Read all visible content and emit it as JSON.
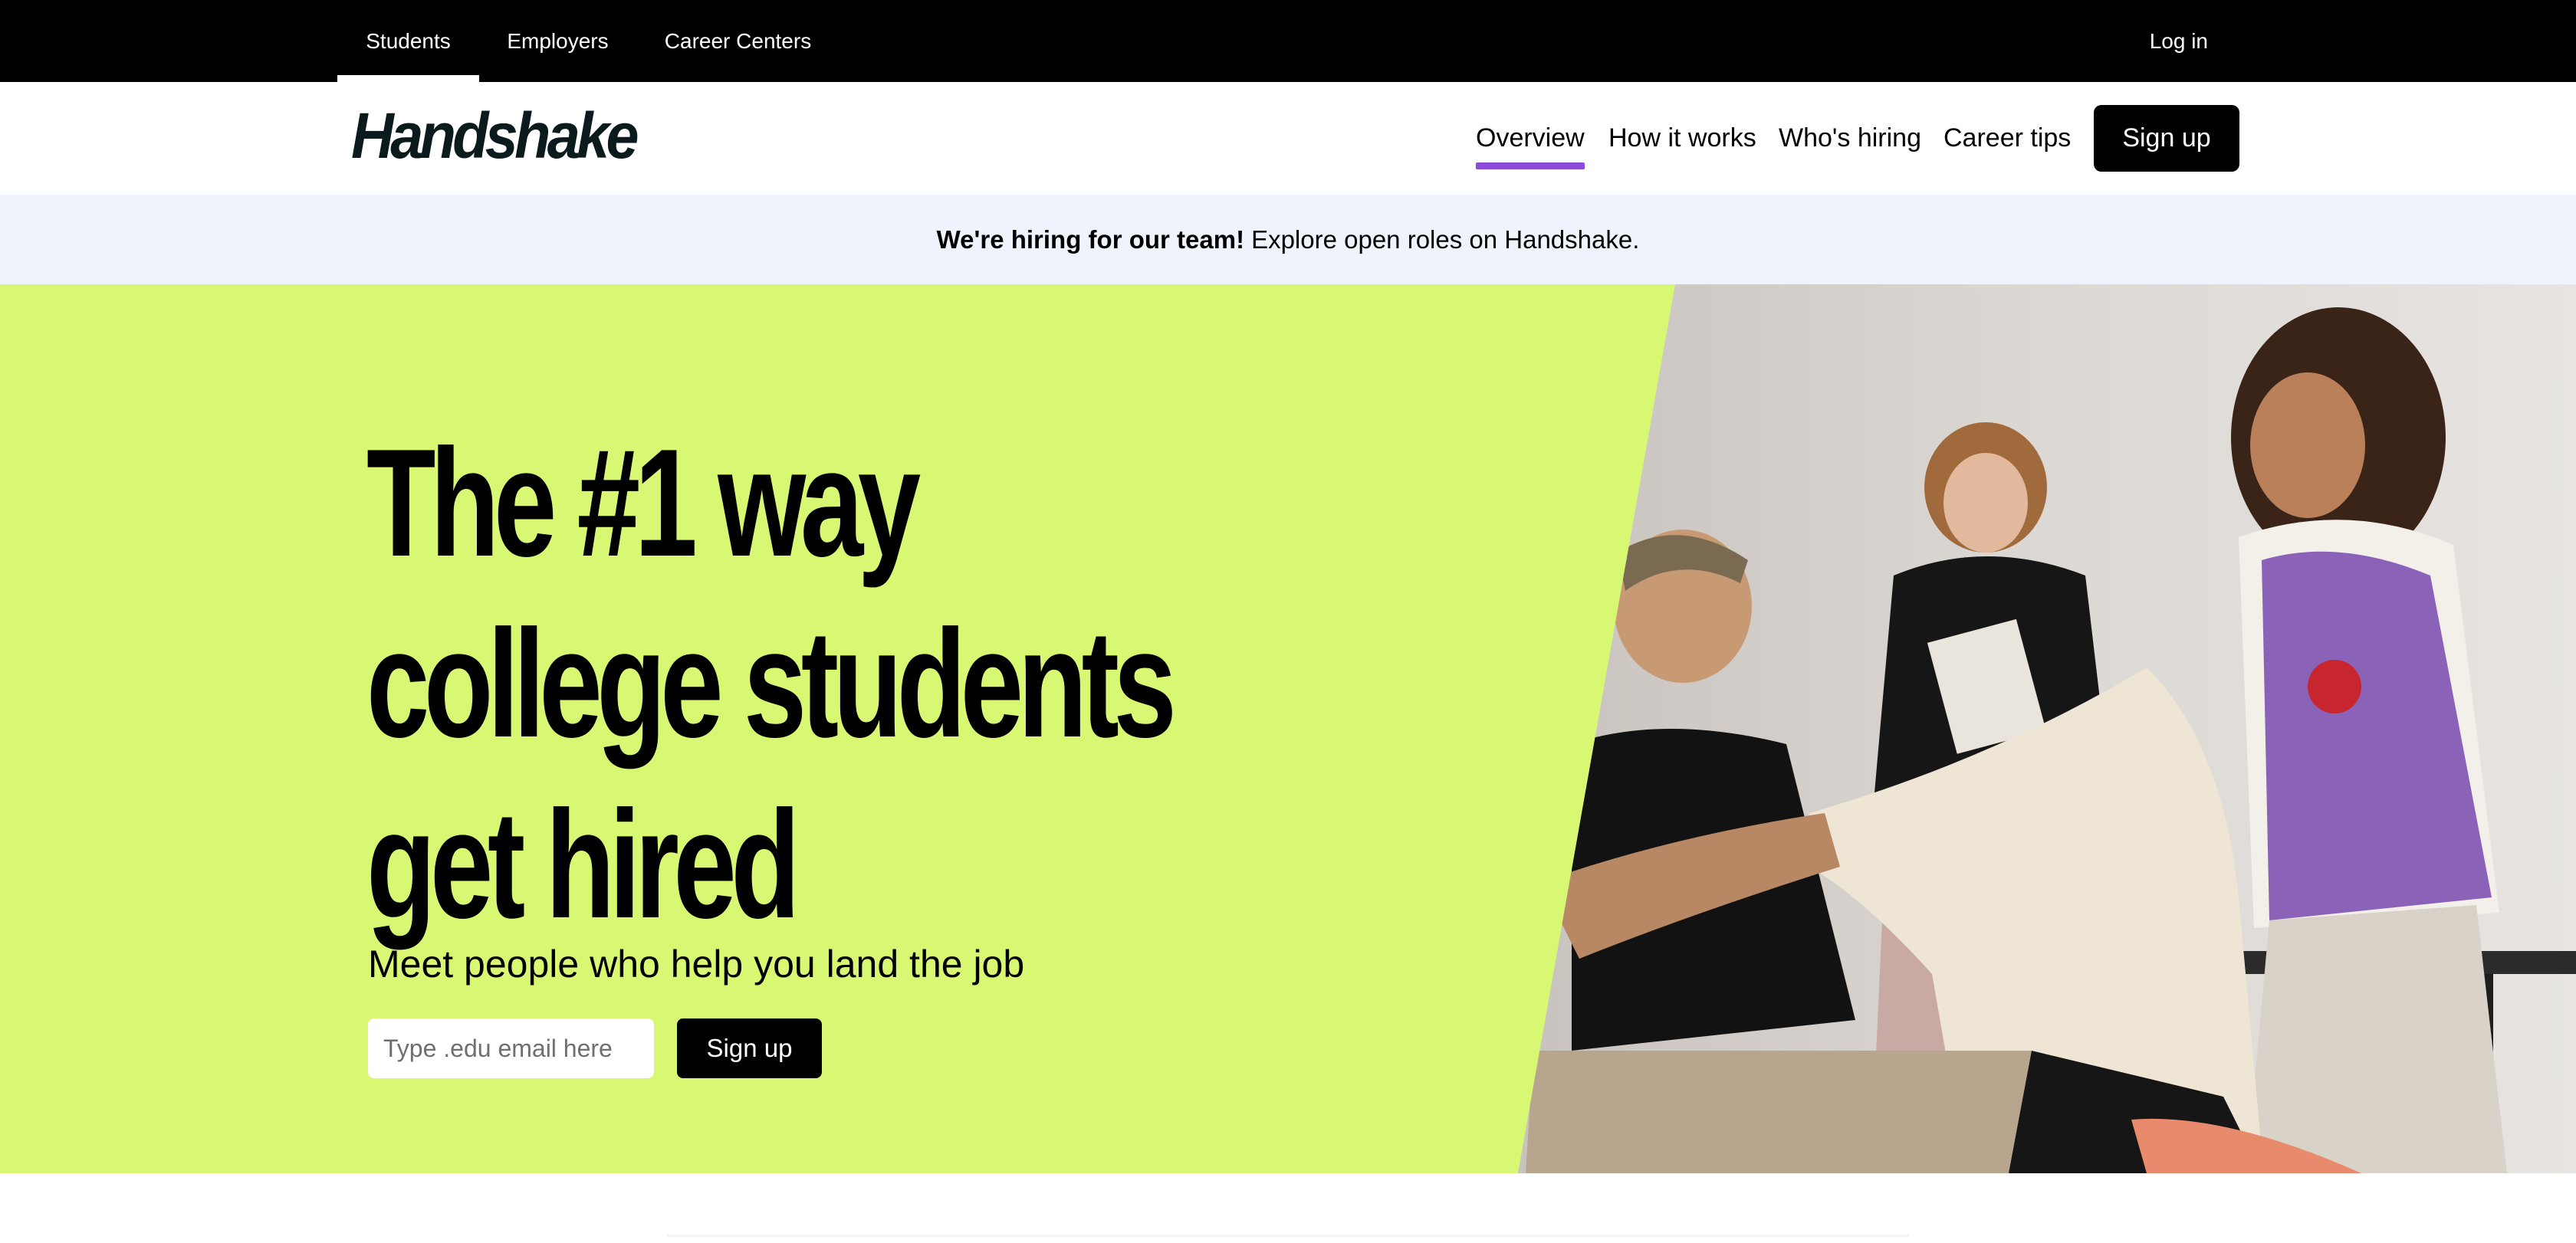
{
  "top_bar": {
    "tabs": [
      {
        "label": "Students",
        "active": true
      },
      {
        "label": "Employers",
        "active": false
      },
      {
        "label": "Career Centers",
        "active": false
      }
    ],
    "login_label": "Log in"
  },
  "main_nav": {
    "logo_text": "Handshake",
    "links": [
      {
        "label": "Overview",
        "active": true
      },
      {
        "label": "How it works",
        "active": false
      },
      {
        "label": "Who's hiring",
        "active": false
      },
      {
        "label": "Career tips",
        "active": false
      }
    ],
    "signup_label": "Sign up",
    "active_underline_color": "#8b4cdb"
  },
  "announcement": {
    "bold_text": "We're hiring for our team!",
    "text": "Explore open roles on Handshake."
  },
  "hero": {
    "headline_lines": [
      "The #1 way",
      "college students",
      "get hired"
    ],
    "subheadline": "Meet people who help you land the job",
    "email_placeholder": "Type .edu email here",
    "signup_label": "Sign up",
    "background_color": "#d8f874",
    "photo_icon": "hero-photo-people"
  }
}
